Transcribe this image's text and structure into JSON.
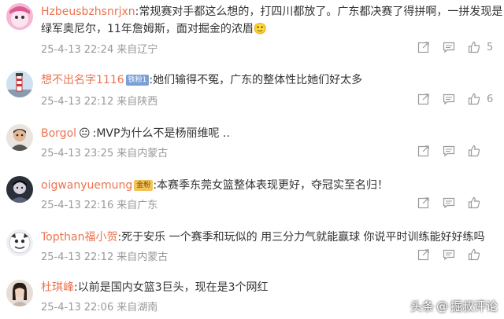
{
  "comments": [
    {
      "username": "Hzbeusbzhsnrjxn",
      "badge": "",
      "text_line1": ":常规赛对手都这么想的，打四川都放了。广东都决赛了得拼啊，一拼发现是",
      "text_line2": "绿军奥尼尔，11年詹姆斯，面对掘金的浓眉🙂",
      "date": "25-4-13",
      "time": "22:24",
      "location": "来自辽宁",
      "likes": "5"
    },
    {
      "username": "想不出名字1116",
      "badge": "铁粉1",
      "text_line1": ":她们输得不冤，广东的整体性比她们好太多",
      "text_line2": "",
      "date": "25-4-13",
      "time": "22:12",
      "location": "来自陕西",
      "likes": "6"
    },
    {
      "username": "Borgol",
      "badge": "",
      "text_line1": ":MVP为什么不是杨丽维呢 ..",
      "text_line2": "",
      "date": "25-4-13",
      "time": "23:25",
      "location": "来自内蒙古",
      "likes": ""
    },
    {
      "username": "oigwanyuemung",
      "badge": "金粉",
      "text_line1": ":本赛季东莞女篮整体表现更好，夺冠实至名归！",
      "text_line2": "",
      "date": "25-4-13",
      "time": "22:16",
      "location": "来自广东",
      "likes": ""
    },
    {
      "username": "Topthan福小贺",
      "badge": "",
      "text_line1": ":死于安乐 一个赛季和玩似的 用三分力气就能赢球 你说平时训练能好好练吗",
      "text_line2": "",
      "date": "25-4-13",
      "time": "22:12",
      "location": "来自内蒙古",
      "likes": ""
    },
    {
      "username": "杜琪峰",
      "badge": "",
      "text_line1": ":以前是国内女篮3巨头，现在是3个网红",
      "text_line2": "",
      "date": "25-4-13",
      "time": "22:06",
      "location": "来自湖南",
      "likes": ""
    }
  ],
  "watermark": {
    "prefix": "头条",
    "at": "@",
    "name": "掘叔评论"
  },
  "colors": {
    "username": "#eb7350",
    "meta": "#999999"
  }
}
